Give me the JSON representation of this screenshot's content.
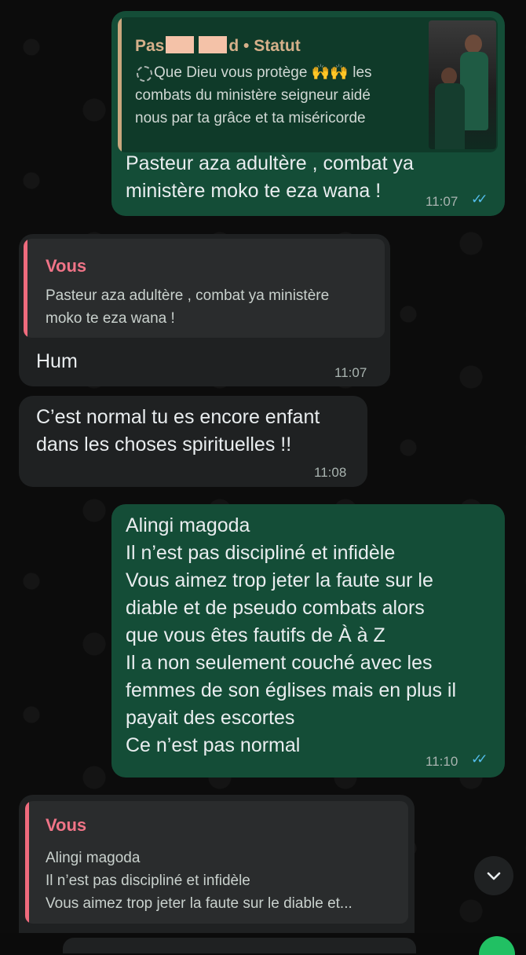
{
  "messages": [
    {
      "quote": {
        "sender": "Pas",
        "sender_suffix": "d • Statut",
        "text": "Que Dieu vous protège 🙌🙌 les\ncombats du ministère seigneur aidé\nnous par ta grâce et ta miséricorde"
      },
      "text": "Pasteur aza adultère , combat ya\nministère moko te eza wana !",
      "time": "11:07",
      "status": "read"
    },
    {
      "quote": {
        "sender": "Vous",
        "text": "Pasteur aza adultère , combat ya ministère\nmoko te eza wana !"
      },
      "text": "Hum",
      "time": "11:07"
    },
    {
      "text": "C’est normal tu es encore enfant\ndans les choses spirituelles !!",
      "time": "11:08"
    },
    {
      "text": "Alingi magoda\nIl n’est pas discipliné et infidèle\nVous aimez trop jeter la faute sur le\ndiable et de pseudo combats alors\nque vous êtes fautifs de À à Z\nIl a non seulement couché avec les\nfemmes de son églises mais en plus il\npayait des escortes\nCe n’est pas normal",
      "time": "11:10",
      "status": "read"
    },
    {
      "quote": {
        "sender": "Vous",
        "text": "Alingi magoda\nIl n’est pas discipliné et infidèle\nVous aimez trop jeter la faute sur le diable et..."
      }
    }
  ],
  "icons": {
    "status_ring": "status-ring-icon",
    "read_receipt": "double-check-icon",
    "scroll_down": "chevron-down-icon"
  },
  "colors": {
    "outgoing_bubble": "#144d37",
    "incoming_bubble": "#1f2122",
    "quote_status_bar": "#c9a77e",
    "quote_self_bar": "#ef6b7d",
    "quote_self_name": "#f07487",
    "quote_status_name": "#d6b08a",
    "read_ticks": "#53bdeb"
  }
}
